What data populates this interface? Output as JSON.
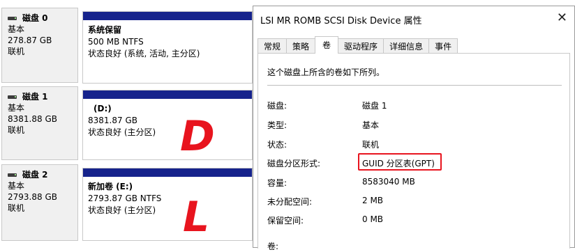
{
  "disks": [
    {
      "name": "磁盘 0",
      "type": "基本",
      "size": "278.87 GB",
      "status": "联机",
      "partition": {
        "label": "系统保留",
        "size_fs": "500 MB NTFS",
        "health": "状态良好 (系统, 活动, 主分区)"
      }
    },
    {
      "name": "磁盘 1",
      "type": "基本",
      "size": "8381.88 GB",
      "status": "联机",
      "partition": {
        "label": "(D:)",
        "size_fs": "8381.87 GB",
        "health": "状态良好 (主分区)"
      }
    },
    {
      "name": "磁盘 2",
      "type": "基本",
      "size": "2793.88 GB",
      "status": "联机",
      "partition": {
        "label": "新加卷 (E:)",
        "size_fs": "2793.87 GB NTFS",
        "health": "状态良好 (主分区)"
      }
    }
  ],
  "annotations": [
    "D",
    "L"
  ],
  "dialog": {
    "title": "LSI MR ROMB SCSI Disk Device 属性",
    "close_glyph": "✕",
    "tabs": [
      "常规",
      "策略",
      "卷",
      "驱动程序",
      "详细信息",
      "事件"
    ],
    "active_tab": "卷",
    "description": "这个磁盘上所含的卷如下所列。",
    "fields": [
      {
        "label": "磁盘:",
        "value": "磁盘 1"
      },
      {
        "label": "类型:",
        "value": "基本"
      },
      {
        "label": "状态:",
        "value": "联机"
      },
      {
        "label": "磁盘分区形式:",
        "value": "GUID 分区表(GPT)"
      },
      {
        "label": "容量:",
        "value": "8583040 MB"
      },
      {
        "label": "未分配空间:",
        "value": "2 MB"
      },
      {
        "label": "保留空间:",
        "value": "0 MB"
      }
    ],
    "volumes_label": "卷:"
  },
  "colors": {
    "partition_bar": "#16238c",
    "annotation_red": "#e8141e",
    "panel_gray": "#f0f0f0"
  }
}
